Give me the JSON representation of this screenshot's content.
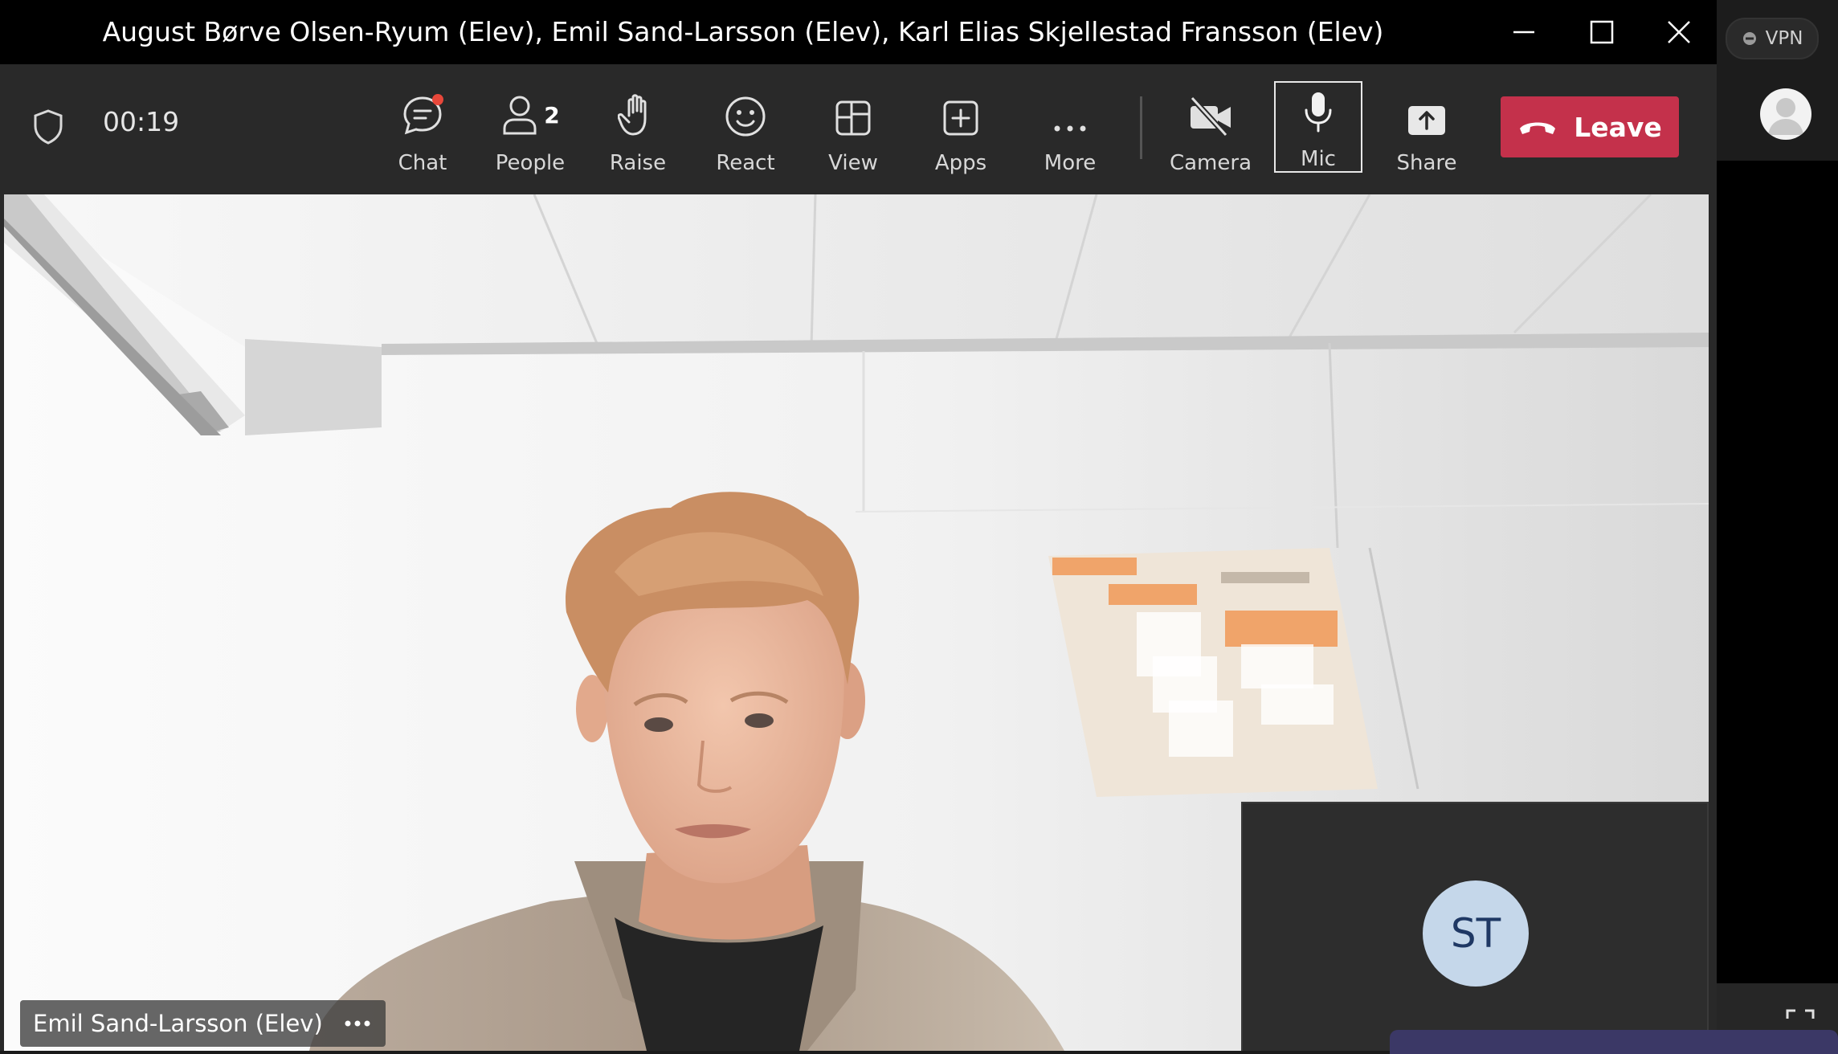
{
  "window": {
    "title": "August Børve Olsen-Ryum (Elev), Emil Sand-Larsson (Elev), Karl Elias Skjellestad Fransson (Elev)",
    "controls": {
      "minimize": "minimize-icon",
      "maximize": "maximize-icon",
      "close": "close-icon"
    }
  },
  "toolbar": {
    "timer": "00:19",
    "buttons": {
      "chat": {
        "label": "Chat",
        "icon": "chat-icon",
        "has_notification": true
      },
      "people": {
        "label": "People",
        "icon": "people-icon",
        "count": "2"
      },
      "raise": {
        "label": "Raise",
        "icon": "hand-icon"
      },
      "react": {
        "label": "React",
        "icon": "smiley-icon"
      },
      "view": {
        "label": "View",
        "icon": "view-grid-icon"
      },
      "apps": {
        "label": "Apps",
        "icon": "plus-box-icon"
      },
      "more": {
        "label": "More",
        "icon": "ellipsis-icon"
      },
      "camera": {
        "label": "Camera",
        "icon": "camera-off-icon",
        "state": "off"
      },
      "mic": {
        "label": "Mic",
        "icon": "microphone-icon",
        "state": "on"
      },
      "share": {
        "label": "Share",
        "icon": "share-icon"
      }
    },
    "leave": {
      "label": "Leave",
      "icon": "phone-hangup-icon"
    }
  },
  "stage": {
    "speaker_name": "Emil Sand-Larsson (Elev)",
    "self_tile": {
      "initials": "ST"
    }
  },
  "side": {
    "vpn_label": "VPN"
  },
  "colors": {
    "leave_red": "#c4314b",
    "notification_dot": "#e8473a",
    "avatar_bg": "#c5d7ea",
    "avatar_text": "#1f3864"
  }
}
